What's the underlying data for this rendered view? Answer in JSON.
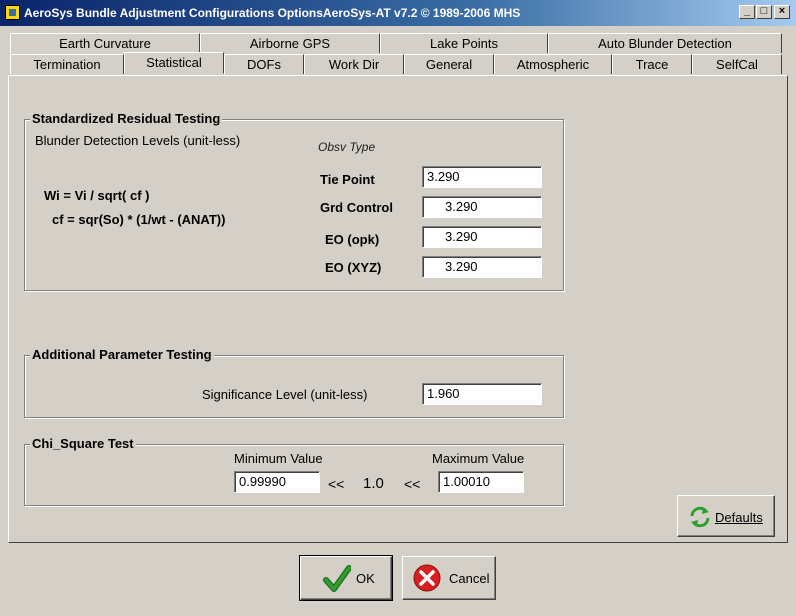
{
  "window": {
    "title": "AeroSys Bundle Adjustment Configurations OptionsAeroSys-AT  v7.2 © 1989-2006 MHS",
    "min_glyph": "_",
    "max_glyph": "□",
    "close_glyph": "×"
  },
  "tabs_row1": [
    "Earth Curvature",
    "Airborne GPS",
    "Lake Points",
    "Auto Blunder Detection"
  ],
  "tabs_row2": [
    "Termination",
    "Statistical",
    "DOFs",
    "Work Dir",
    "General",
    "Atmospheric",
    "Trace",
    "SelfCal"
  ],
  "active_tab": "Statistical",
  "residual": {
    "title": "Standardized Residual Testing",
    "subtitle": "Blunder Detection Levels (unit-less)",
    "obsv_type": "Obsv Type",
    "formula1": "Wi = Vi / sqrt( cf )",
    "formula2": "cf = sqr(So) * (1/wt  -  (ANAT))",
    "rows": [
      {
        "label": "Tie Point",
        "value": "3.290"
      },
      {
        "label": "Grd Control",
        "value": "3.290"
      },
      {
        "label": "EO (opk)",
        "value": "3.290"
      },
      {
        "label": "EO (XYZ)",
        "value": "3.290"
      }
    ]
  },
  "additional": {
    "title": "Additional Parameter Testing",
    "sig_label": "Significance Level (unit-less)",
    "sig_value": "1.960"
  },
  "chi": {
    "title": "Chi_Square Test",
    "min_label": "Minimum Value",
    "max_label": "Maximum Value",
    "min_value": "0.99990",
    "max_value": "1.00010",
    "ltlt1": "<<",
    "center": "1.0",
    "ltlt2": "<<"
  },
  "buttons": {
    "defaults": "Defaults",
    "ok": "OK",
    "cancel": "Cancel"
  },
  "colors": {
    "dialog_bg": "#d4d0c8",
    "title_bar": "#0a246a",
    "ok_check": "#2e9e2e",
    "cancel_red": "#d81e1e",
    "defaults_green": "#2e9e2e"
  },
  "icons": [
    "app-icon",
    "minimize-icon",
    "maximize-icon",
    "close-icon",
    "refresh-icon",
    "checkmark-icon",
    "cancel-x-icon"
  ]
}
